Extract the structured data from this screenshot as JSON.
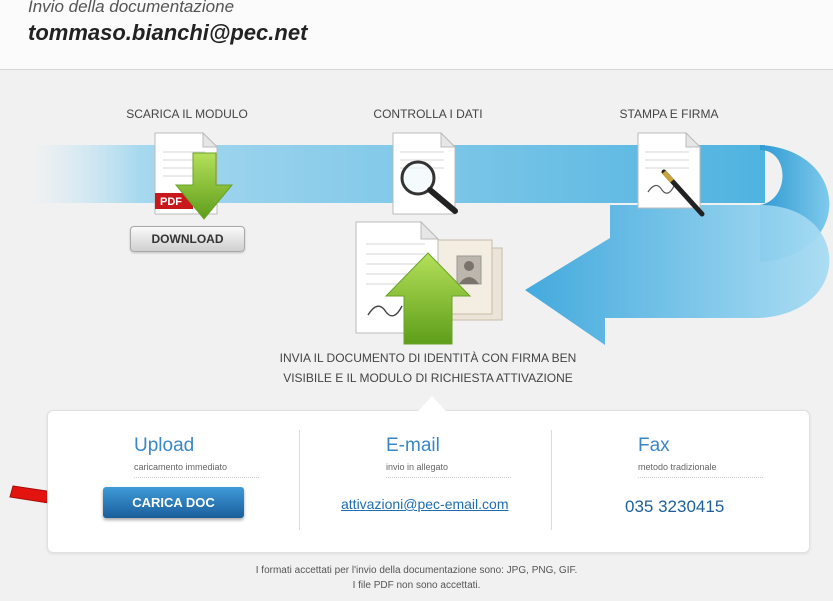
{
  "header": {
    "subtitle": "Invio della documentazione",
    "email": "tommaso.bianchi@pec.net"
  },
  "steps": {
    "download": {
      "label": "SCARICA IL MODULO",
      "button": "DOWNLOAD",
      "pdf_badge": "PDF"
    },
    "check": {
      "label": "CONTROLLA I DATI"
    },
    "sign": {
      "label": "STAMPA E FIRMA"
    }
  },
  "instruction": {
    "line1": "INVIA IL DOCUMENTO DI IDENTITÀ CON FIRMA BEN",
    "line2": "VISIBILE E IL MODULO DI RICHIESTA ATTIVAZIONE"
  },
  "options": {
    "upload": {
      "title": "Upload",
      "subtitle": "caricamento immediato",
      "button": "CARICA DOC"
    },
    "email": {
      "title": "E-mail",
      "subtitle": "invio in allegato",
      "address": "attivazioni@pec-email.com"
    },
    "fax": {
      "title": "Fax",
      "subtitle": "metodo tradizionale",
      "number": "035 3230415"
    }
  },
  "footer": {
    "line1": "I formati accettati per l'invio della documentazione sono: JPG, PNG, GIF.",
    "line2": "I file PDF non sono accettati."
  },
  "colors": {
    "accent": "#3a87c8",
    "button_blue": "#1a5e9b",
    "arrow_green": "#7fbf2a",
    "flow_blue": "#4fb3e0",
    "pointer_red": "#e3140f"
  }
}
